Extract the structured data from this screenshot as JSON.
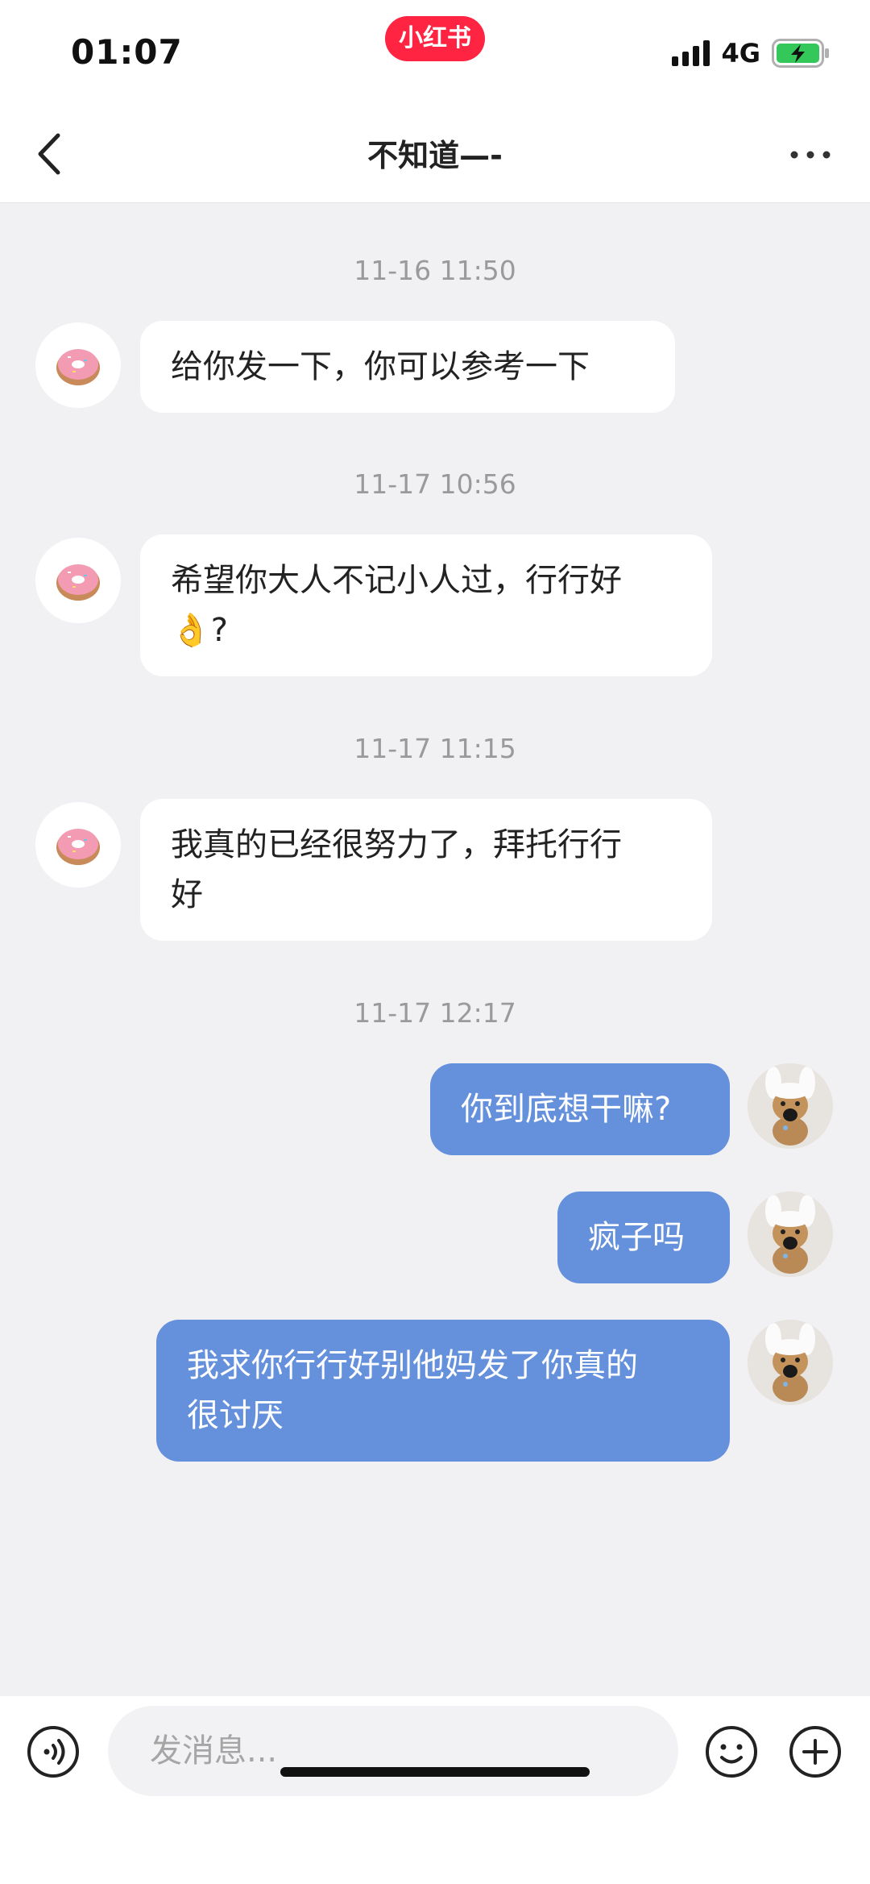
{
  "status_bar": {
    "time": "01:07",
    "app_badge": "小红书",
    "network": "4G",
    "battery_color": "#34c759",
    "badge_color": "#ff2442"
  },
  "nav": {
    "title": "不知道—-",
    "back_icon": "chevron-left-icon",
    "more_icon": "more-horizontal-icon"
  },
  "messages": [
    {
      "time": "11-16 11:50",
      "direction": "in",
      "lines": [
        "给你发一下，你可以参考一下"
      ],
      "avatar": "donut-icon"
    },
    {
      "time": "11-17 10:56",
      "direction": "in",
      "lines": [
        "希望你大人不记小人过，行行好",
        "👌?"
      ],
      "avatar": "donut-icon"
    },
    {
      "time": "11-17 11:15",
      "direction": "in",
      "lines": [
        "我真的已经很努力了，拜托行行",
        "好"
      ],
      "avatar": "donut-icon"
    },
    {
      "time": "11-17 12:17",
      "direction": "out",
      "lines": [
        "你到底想干嘛?"
      ],
      "avatar": "puppy-avatar"
    },
    {
      "time": "",
      "direction": "out",
      "lines": [
        "疯子吗"
      ],
      "avatar": "puppy-avatar"
    },
    {
      "time": "",
      "direction": "out",
      "lines": [
        "我求你行行好别他妈发了你真的",
        "很讨厌"
      ],
      "avatar": "puppy-avatar"
    }
  ],
  "colors": {
    "outgoing_bubble": "#6590db",
    "incoming_bubble": "#ffffff",
    "background": "#f1f1f3"
  },
  "input": {
    "placeholder": "发消息...",
    "voice_icon": "voice-icon",
    "emoji_icon": "emoji-icon",
    "plus_icon": "plus-circle-icon"
  }
}
